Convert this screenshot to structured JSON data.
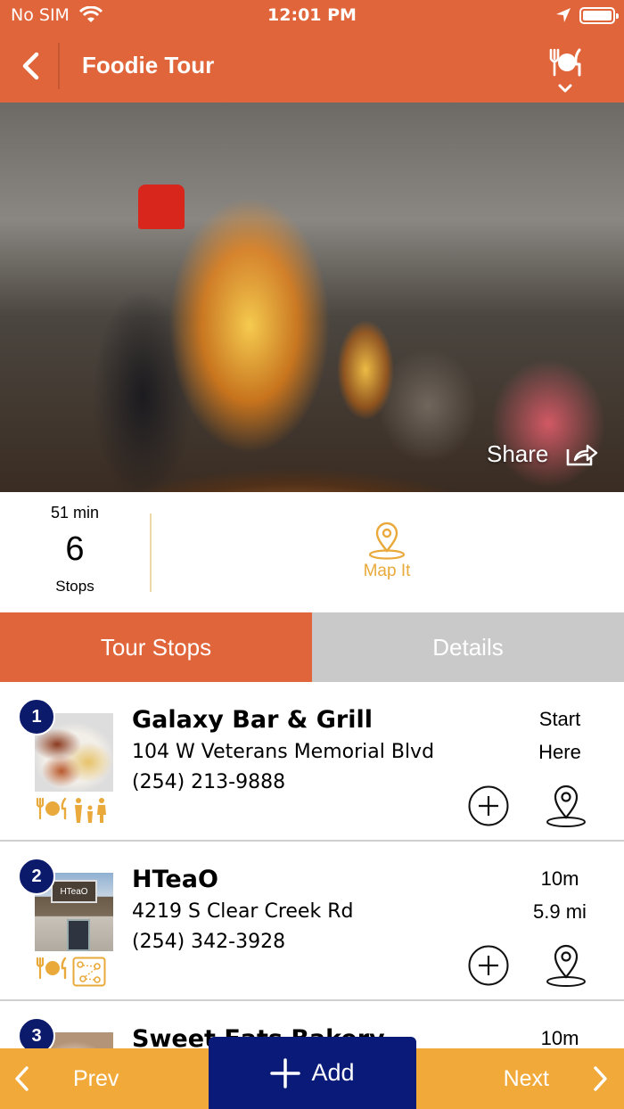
{
  "status_bar": {
    "carrier": "No SIM",
    "time": "12:01 PM"
  },
  "nav": {
    "title": "Foodie Tour"
  },
  "hero": {
    "share_label": "Share"
  },
  "summary": {
    "duration": "51 min",
    "stop_count": "6",
    "stop_label": "Stops",
    "map_label": "Map It"
  },
  "tabs": [
    {
      "label": "Tour Stops",
      "active": true
    },
    {
      "label": "Details",
      "active": false
    }
  ],
  "stops": [
    {
      "number": "1",
      "name": "Galaxy Bar & Grill",
      "address": "104 W Veterans Memorial Blvd",
      "phone": "(254) 213-9888",
      "meta_top": "Start",
      "meta_bottom": "Here",
      "categories": [
        "dining-icon",
        "family-icon"
      ]
    },
    {
      "number": "2",
      "name": "HTeaO",
      "address": "4219 S Clear Creek Rd",
      "phone": "(254) 342-3928",
      "meta_top": "10m",
      "meta_bottom": "5.9 mi",
      "thumb_sign": "HTeaO",
      "categories": [
        "dining-icon",
        "map-trail-icon"
      ]
    },
    {
      "number": "3",
      "name": "Sweet Eats Bakery",
      "meta_top": "10m"
    }
  ],
  "bottom_bar": {
    "prev_label": "Prev",
    "add_label": "Add",
    "next_label": "Next"
  },
  "colors": {
    "brand": "#e1653a",
    "accent": "#f1a93a",
    "navy": "#0a1a78",
    "gold": "#e9a93b",
    "inactive_tab": "#c9c9c9"
  }
}
